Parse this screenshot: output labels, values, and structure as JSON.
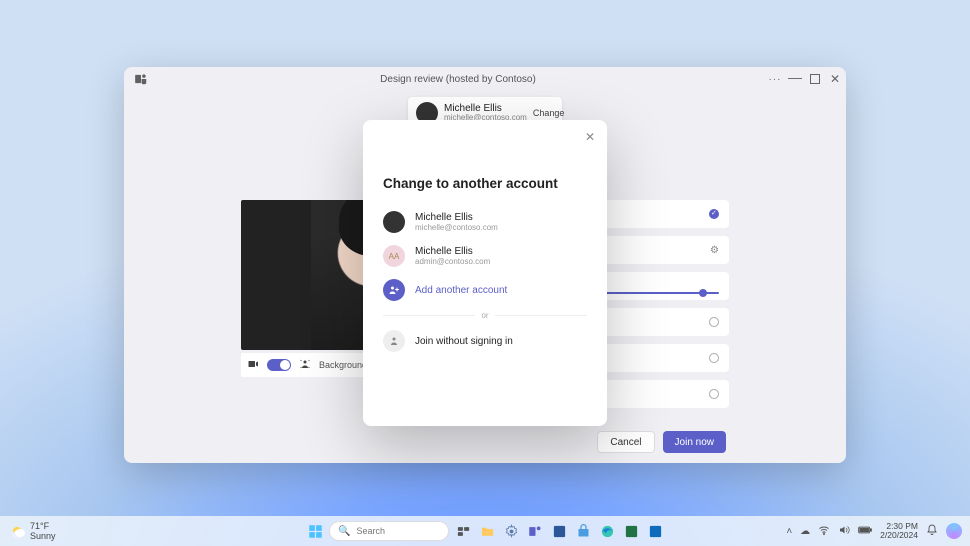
{
  "window": {
    "title": "Design review (hosted by Contoso)"
  },
  "account_pill": {
    "name": "Michelle Ellis",
    "email": "michelle@contoso.com",
    "change_label": "Change"
  },
  "video_controls": {
    "bg_filters_label": "Background filters"
  },
  "join_actions": {
    "cancel": "Cancel",
    "join": "Join now"
  },
  "modal": {
    "title": "Change to another account",
    "accounts": [
      {
        "name": "Michelle Ellis",
        "email": "michelle@contoso.com",
        "avatar_type": "photo"
      },
      {
        "name": "Michelle Ellis",
        "email": "admin@contoso.com",
        "avatar_type": "initials",
        "initials": "AA"
      }
    ],
    "add_label": "Add another account",
    "or_label": "or",
    "guest_label": "Join without signing in"
  },
  "taskbar": {
    "weather": {
      "temp": "71°F",
      "desc": "Sunny"
    },
    "search_placeholder": "Search",
    "clock": {
      "time": "2:30 PM",
      "date": "2/20/2024"
    }
  }
}
